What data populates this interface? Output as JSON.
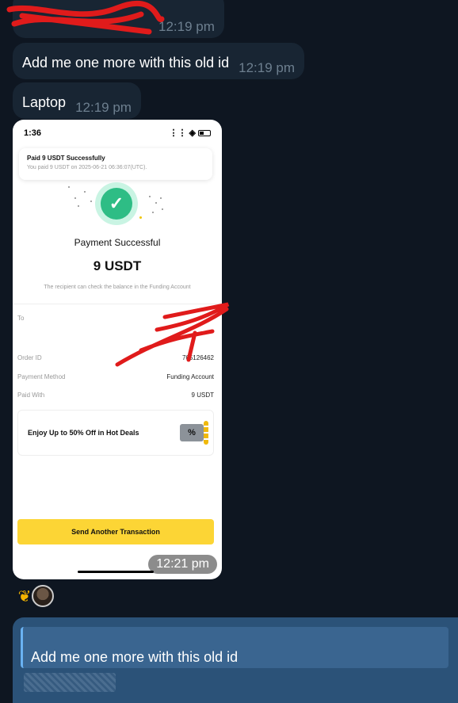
{
  "messages": [
    {
      "text": "",
      "time": "12:19 pm"
    },
    {
      "text": "Add me one more with this old id",
      "time": "12:19 pm"
    },
    {
      "text": "Laptop",
      "time": "12:19 pm"
    }
  ],
  "screenshot": {
    "status_time": "1:36",
    "toast_title": "Paid 9 USDT Successfully",
    "toast_sub": "You paid 9 USDT on 2025-06-21 06:36:07(UTC).",
    "title": "Payment Successful",
    "amount": "9 USDT",
    "note": "The recipient can check the balance in the Funding Account",
    "to_label": "To",
    "order_label": "Order ID",
    "order_value": "765126462",
    "method_label": "Payment Method",
    "method_value": "Funding Account",
    "paid_label": "Paid With",
    "paid_value": "9 USDT",
    "promo": "Enjoy Up to 50% Off in Hot Deals",
    "button": "Send Another Transaction",
    "time": "12:21 pm"
  },
  "reply": {
    "quoted_text": "Add me one more with this old id"
  },
  "colors": {
    "background": "#0e1621",
    "incoming_bubble": "#182533",
    "outgoing_bubble": "#2b5278",
    "success_green": "#2ebd85",
    "button_yellow": "#fcd535",
    "redaction_red": "#e01b1b"
  }
}
